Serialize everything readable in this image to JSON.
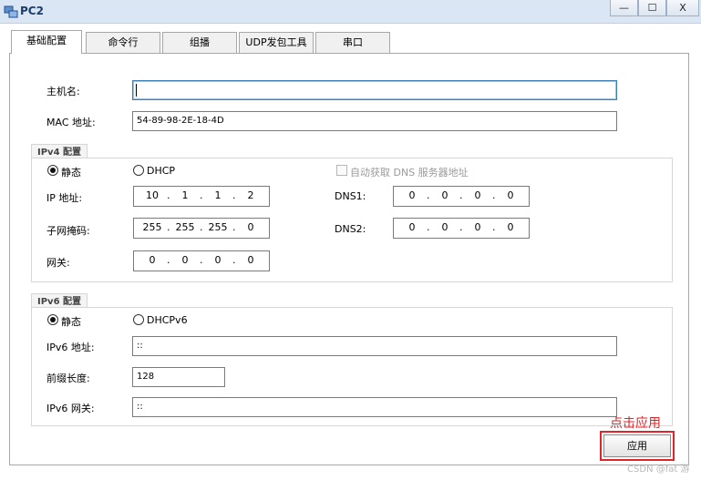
{
  "window": {
    "title": "PC2",
    "minimize": "—",
    "maximize": "☐",
    "close": "X"
  },
  "tabs": [
    "基础配置",
    "命令行",
    "组播",
    "UDP发包工具",
    "串口"
  ],
  "basic": {
    "hostname_label": "主机名:",
    "hostname_value": "",
    "mac_label": "MAC 地址:",
    "mac_value": "54-89-98-2E-18-4D"
  },
  "ipv4": {
    "group_title": "IPv4 配置",
    "static_label": "静态",
    "dhcp_label": "DHCP",
    "auto_dns_label": "自动获取 DNS 服务器地址",
    "ip_label": "IP 地址:",
    "ip": [
      "10",
      "1",
      "1",
      "2"
    ],
    "mask_label": "子网掩码:",
    "mask": [
      "255",
      "255",
      "255",
      "0"
    ],
    "gateway_label": "网关:",
    "gateway": [
      "0",
      "0",
      "0",
      "0"
    ],
    "dns1_label": "DNS1:",
    "dns1": [
      "0",
      "0",
      "0",
      "0"
    ],
    "dns2_label": "DNS2:",
    "dns2": [
      "0",
      "0",
      "0",
      "0"
    ]
  },
  "ipv6": {
    "group_title": "IPv6 配置",
    "static_label": "静态",
    "dhcp_label": "DHCPv6",
    "ip_label": "IPv6 地址:",
    "ip_value": "::",
    "prefix_label": "前缀长度:",
    "prefix_value": "128",
    "gateway_label": "IPv6 网关:",
    "gateway_value": "::"
  },
  "apply_button": "应用",
  "annotation": "点击应用",
  "watermark": "CSDN @fat 游"
}
